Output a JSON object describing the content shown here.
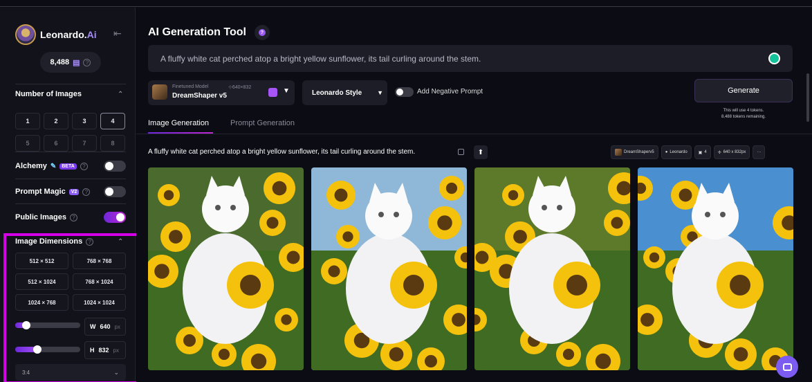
{
  "sidebar": {
    "brand": {
      "name": "Leonardo.",
      "suffix": "Ai"
    },
    "tokens": "8,488",
    "number_of_images": {
      "title": "Number of Images",
      "options": [
        "1",
        "2",
        "3",
        "4",
        "5",
        "6",
        "7",
        "8"
      ],
      "selected": "4"
    },
    "alchemy": {
      "label": "Alchemy",
      "badge": "BETA",
      "enabled": false
    },
    "prompt_magic": {
      "label": "Prompt Magic",
      "badge": "V2",
      "enabled": false
    },
    "public_images": {
      "label": "Public Images",
      "enabled": true
    },
    "image_dimensions": {
      "title": "Image Dimensions",
      "presets": [
        "512 × 512",
        "768 × 768",
        "512 × 1024",
        "768 × 1024",
        "1024 × 768",
        "1024 × 1024"
      ],
      "width": {
        "label": "W",
        "value": "640",
        "unit": "px",
        "slider_fraction": 0.15
      },
      "height": {
        "label": "H",
        "value": "832",
        "unit": "px",
        "slider_fraction": 0.32
      },
      "aspect_ratio": "3:4"
    }
  },
  "main": {
    "title": "AI Generation Tool",
    "prompt": "A fluffy white cat perched atop a bright yellow sunflower, its tail curling around the stem.",
    "model": {
      "caption": "Finetuned Model",
      "resolution": "640×832",
      "name": "DreamShaper v5"
    },
    "style": "Leonardo Style",
    "negative_prompt": {
      "label": "Add Negative Prompt",
      "enabled": false
    },
    "generate": {
      "label": "Generate",
      "note_line1": "This will use 4 tokens.",
      "note_line2": "8,488 tokens remaining."
    },
    "tabs": [
      {
        "label": "Image Generation",
        "active": true
      },
      {
        "label": "Prompt Generation",
        "active": false
      }
    ],
    "generation": {
      "prompt": "A fluffy white cat perched atop a bright yellow sunflower, its tail curling around the stem.",
      "tags": {
        "model": "DreamShaperv5",
        "style": "Leonardo",
        "count": "4",
        "size": "640 x 832px",
        "more": "···"
      },
      "images": [
        "cat-sunflower-1",
        "cat-sunflower-2",
        "cat-sunflower-3",
        "cat-sunflower-4"
      ]
    }
  },
  "colors": {
    "accent": "#a855f7",
    "highlight": "#d400e8",
    "background": "#0b0c14"
  }
}
